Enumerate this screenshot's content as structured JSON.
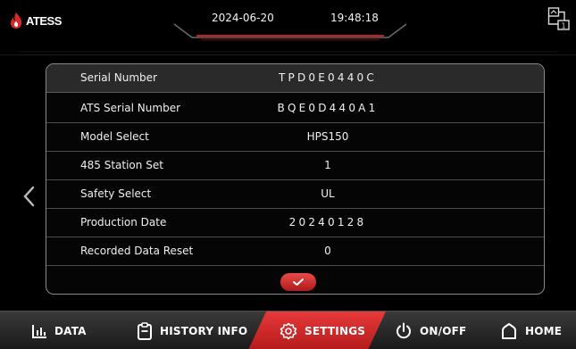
{
  "header": {
    "brand": "ATESS",
    "date": "2024-06-20",
    "time": "19:48:18"
  },
  "panel": {
    "rows": [
      {
        "label": "Serial Number",
        "value": "TPD0E0440C"
      },
      {
        "label": "ATS Serial Number",
        "value": "BQE0D440A1"
      },
      {
        "label": "Model Select",
        "value": "HPS150"
      },
      {
        "label": "485 Station Set",
        "value": "1"
      },
      {
        "label": "Safety Select",
        "value": "UL"
      },
      {
        "label": "Production Date",
        "value": "20240128"
      },
      {
        "label": "Recorded Data Reset",
        "value": "0"
      }
    ]
  },
  "nav": {
    "data": "DATA",
    "history": "HISTORY INFO",
    "settings": "SETTINGS",
    "onoff": "ON/OFF",
    "home": "HOME",
    "active": "settings"
  },
  "colors": {
    "accent": "#d42a2a",
    "panel_border": "#8a8a8a",
    "header_row": "#2a2a2a"
  },
  "icons": {
    "brand": "flame-logo-icon",
    "comm": "communication-status-icon",
    "back": "chevron-left-icon",
    "confirm": "checkmark-icon",
    "data": "bar-chart-icon",
    "history": "clipboard-icon",
    "settings": "gear-icon",
    "onoff": "power-icon",
    "home": "home-icon"
  }
}
